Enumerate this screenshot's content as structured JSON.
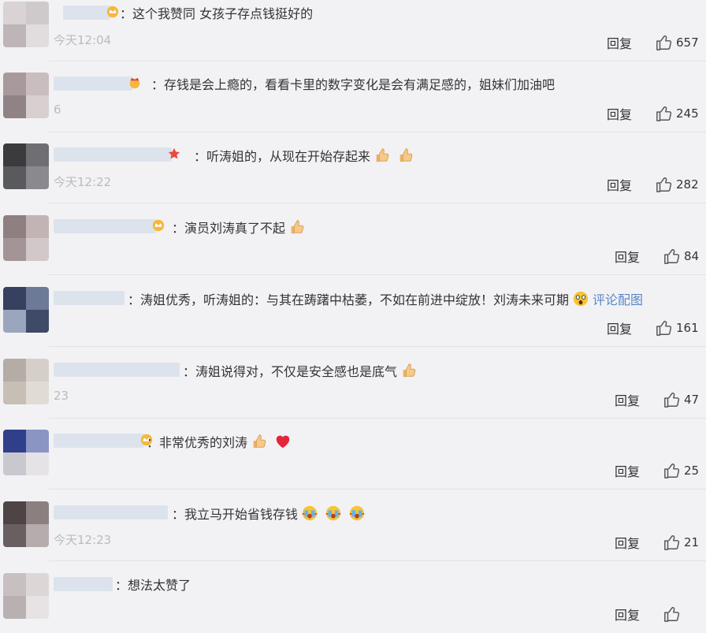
{
  "reply_label": "回复",
  "comments": [
    {
      "time": "今天12:04",
      "prefix": "：",
      "text": "这个我赞同 女孩子存点钱挺好的",
      "likes": "657"
    },
    {
      "time": "6",
      "prefix": "：",
      "text": "存钱是会上瘾的，看看卡里的数字变化是会有满足感的，姐妹们加油吧",
      "likes": "245"
    },
    {
      "time": "今天12:22",
      "prefix": "：",
      "text": "听涛姐的，从现在开始存起来",
      "likes": "282"
    },
    {
      "time": "",
      "prefix": "：",
      "text": "演员刘涛真了不起",
      "likes": "84"
    },
    {
      "time": "",
      "prefix": "：",
      "text": "涛姐优秀，听涛姐的：与其在踌躇中枯萎，不如在前进中绽放！刘涛未来可期",
      "link": "评论配图",
      "likes": "161"
    },
    {
      "time": "23",
      "prefix": "：",
      "text": "涛姐说得对，不仅是安全感也是底气",
      "likes": "47"
    },
    {
      "time": "",
      "prefix": "：",
      "text": "非常优秀的刘涛",
      "likes": "25"
    },
    {
      "time": "今天12:23",
      "prefix": "：",
      "text": "我立马开始省钱存钱",
      "likes": "21"
    },
    {
      "time": "",
      "prefix": "：",
      "text": "想法太赞了",
      "likes": ""
    }
  ]
}
